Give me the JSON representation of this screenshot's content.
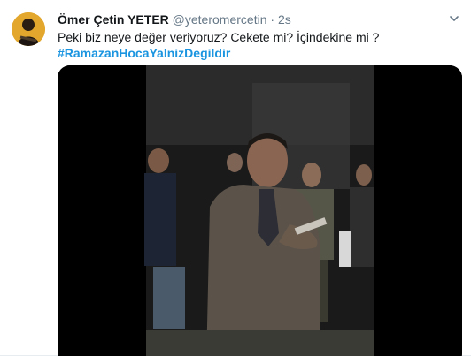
{
  "tweet": {
    "author_name": "Ömer Çetin YETER",
    "author_handle": "@yeteromercetin",
    "separator": "·",
    "timestamp": "2s",
    "text": "Peki biz neye değer veriyoruz? Cekete mi? İçindekine mi ?",
    "hashtag": "#RamazanHocaYalnizDegildir"
  },
  "colors": {
    "link": "#1b95e0",
    "name": "#14171a",
    "secondary": "#657786",
    "avatar_bg": "#e2a72c"
  },
  "icons": {
    "caret": "chevron-down-icon",
    "avatar": "avatar"
  }
}
